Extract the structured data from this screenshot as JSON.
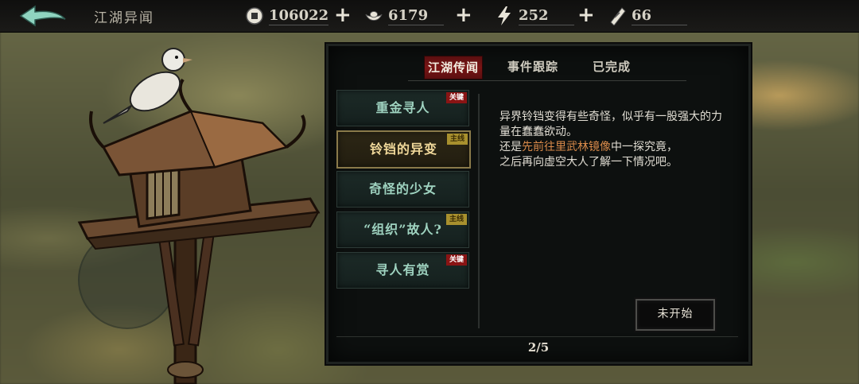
{
  "header": {
    "title": "江湖异闻",
    "resources": [
      {
        "icon": "coin-icon",
        "value": "106022"
      },
      {
        "icon": "silver-ingot-icon",
        "value": "6179"
      },
      {
        "icon": "lightning-icon",
        "value": "252"
      },
      {
        "icon": "ticket-icon",
        "value": "66"
      }
    ]
  },
  "tabs": [
    {
      "label": "江湖传闻",
      "active": true
    },
    {
      "label": "事件跟踪",
      "active": false
    },
    {
      "label": "已完成",
      "active": false
    }
  ],
  "quests": [
    {
      "label": "重金寻人",
      "tag": "关键",
      "tag_color": "#8a1414"
    },
    {
      "label": "铃铛的异变",
      "tag": "主线",
      "tag_color": "#a8902e",
      "selected": true
    },
    {
      "label": "奇怪的少女",
      "tag": ""
    },
    {
      "label": "“组织”故人?",
      "tag": "主线",
      "tag_color": "#a8902e"
    },
    {
      "label": "寻人有赏",
      "tag": "关键",
      "tag_color": "#8a1414"
    }
  ],
  "detail": {
    "line1": "异界铃铛变得有些奇怪，似乎有一股强大的力量在蠢蠢欲动。",
    "line2_pre": "还是",
    "line2_highlight": "先前往里武林镜像",
    "line2_post": "中一探究竟，",
    "line3": "之后再向虚空大人了解一下情况吧。",
    "button_label": "未开始"
  },
  "pagination": "2/5",
  "colors": {
    "accent_red": "#7a1515",
    "highlight_orange": "#d98a4a",
    "quest_text": "#9fd3c0"
  }
}
